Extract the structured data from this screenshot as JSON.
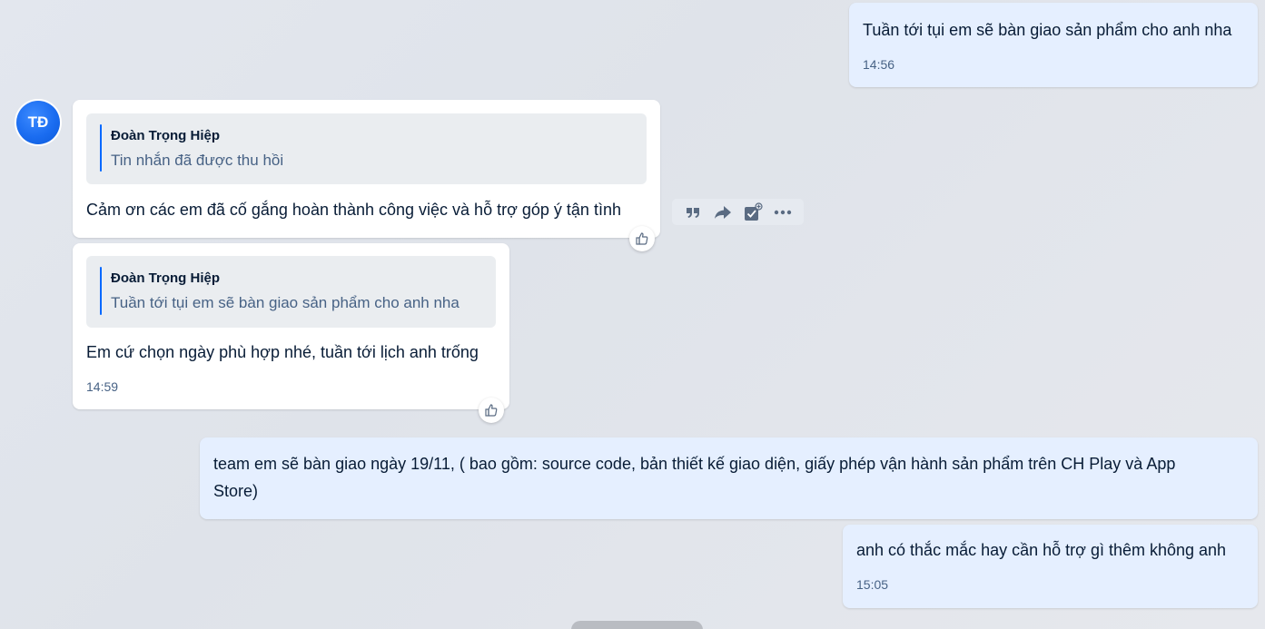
{
  "colors": {
    "my_bubble": "#e5efff",
    "other_bubble": "#ffffff",
    "accent": "#0068ff",
    "text": "#081c36",
    "secondary_text": "#476285"
  },
  "avatar": {
    "initials": "TĐ"
  },
  "messages": [
    {
      "text": "Tuần tới tụi em sẽ bàn giao sản phẩm cho anh nha",
      "time": "14:56"
    },
    {
      "quote_author": "Đoàn Trọng Hiệp",
      "quote_text": "Tin nhắn đã được thu hồi",
      "text": "Cảm ơn các em đã cố gắng hoàn thành công việc và hỗ trợ góp ý tận tình"
    },
    {
      "quote_author": "Đoàn Trọng Hiệp",
      "quote_text": "Tuần tới tụi em sẽ bàn giao sản phẩm cho anh nha",
      "text": "Em cứ chọn ngày phù hợp nhé, tuần tới lịch anh trống",
      "time": "14:59"
    },
    {
      "text_line1": "team em sẽ bàn giao ngày 19/11, ( bao gồm: source code, bản thiết kế giao diện, giấy phép vận hành sản phẩm trên CH Play và App",
      "text_line2": "Store)"
    },
    {
      "text": "anh có thắc mắc hay cần hỗ trợ gì thêm không anh",
      "time": "15:05"
    }
  ],
  "toolbar": {
    "icons": [
      "quote-icon",
      "forward-icon",
      "add-task-icon",
      "more-icon"
    ]
  },
  "reaction_icon": "thumbs-up-icon"
}
